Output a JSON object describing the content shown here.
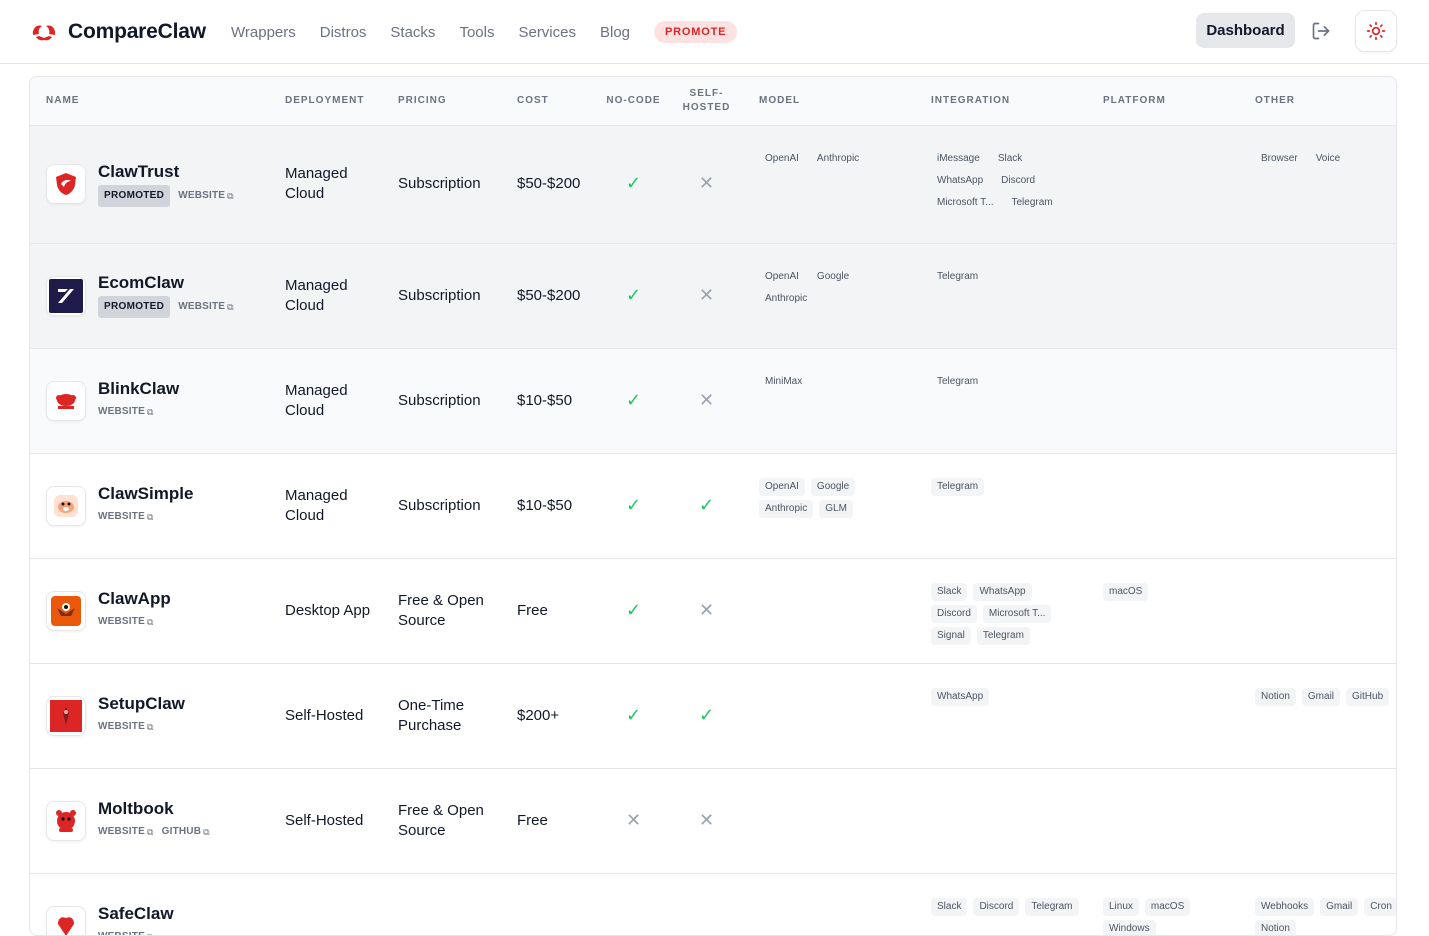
{
  "header": {
    "brand": "CompareClaw",
    "nav": [
      "Wrappers",
      "Distros",
      "Stacks",
      "Tools",
      "Services",
      "Blog"
    ],
    "promote_label": "PROMOTE",
    "dashboard_label": "Dashboard"
  },
  "table": {
    "columns": [
      "NAME",
      "DEPLOYMENT",
      "PRICING",
      "COST",
      "NO-CODE",
      "SELF-HOSTED",
      "MODEL",
      "INTEGRATION",
      "PLATFORM",
      "OTHER"
    ],
    "badge_labels": {
      "promoted": "PROMOTED",
      "website": "WEBSITE",
      "github": "GITHUB"
    },
    "rows": [
      {
        "name": "ClawTrust",
        "promoted": true,
        "links": [
          "WEBSITE"
        ],
        "deployment": "Managed Cloud",
        "pricing": "Subscription",
        "cost": "$50-$200",
        "no_code": true,
        "self_hosted": false,
        "model": [
          "OpenAI",
          "Anthropic"
        ],
        "integration": [
          "iMessage",
          "Slack",
          "WhatsApp",
          "Discord",
          "Microsoft T...",
          "Telegram"
        ],
        "platform": [],
        "other": [
          "Browser",
          "Voice"
        ]
      },
      {
        "name": "EcomClaw",
        "promoted": true,
        "links": [
          "WEBSITE"
        ],
        "deployment": "Managed Cloud",
        "pricing": "Subscription",
        "cost": "$50-$200",
        "no_code": true,
        "self_hosted": false,
        "model": [
          "OpenAI",
          "Google",
          "Anthropic"
        ],
        "integration": [
          "Telegram"
        ],
        "platform": [],
        "other": []
      },
      {
        "name": "BlinkClaw",
        "promoted": false,
        "links": [
          "WEBSITE"
        ],
        "deployment": "Managed Cloud",
        "pricing": "Subscription",
        "cost": "$10-$50",
        "no_code": true,
        "self_hosted": false,
        "model": [
          "MiniMax"
        ],
        "integration": [
          "Telegram"
        ],
        "platform": [],
        "other": []
      },
      {
        "name": "ClawSimple",
        "promoted": false,
        "links": [
          "WEBSITE"
        ],
        "deployment": "Managed Cloud",
        "pricing": "Subscription",
        "cost": "$10-$50",
        "no_code": true,
        "self_hosted": true,
        "model": [
          "OpenAI",
          "Google",
          "Anthropic",
          "GLM"
        ],
        "integration": [
          "Telegram"
        ],
        "platform": [],
        "other": []
      },
      {
        "name": "ClawApp",
        "promoted": false,
        "links": [
          "WEBSITE"
        ],
        "deployment": "Desktop App",
        "pricing": "Free & Open Source",
        "cost": "Free",
        "no_code": true,
        "self_hosted": false,
        "model": [],
        "integration": [
          "Slack",
          "WhatsApp",
          "Discord",
          "Microsoft T...",
          "Signal",
          "Telegram"
        ],
        "platform": [
          "macOS"
        ],
        "other": []
      },
      {
        "name": "SetupClaw",
        "promoted": false,
        "links": [
          "WEBSITE"
        ],
        "deployment": "Self-Hosted",
        "pricing": "One-Time Purchase",
        "cost": "$200+",
        "no_code": true,
        "self_hosted": true,
        "model": [],
        "integration": [
          "WhatsApp"
        ],
        "platform": [],
        "other": [
          "Notion",
          "Gmail",
          "GitHub"
        ]
      },
      {
        "name": "Moltbook",
        "promoted": false,
        "links": [
          "WEBSITE",
          "GITHUB"
        ],
        "deployment": "Self-Hosted",
        "pricing": "Free & Open Source",
        "cost": "Free",
        "no_code": false,
        "self_hosted": false,
        "model": [],
        "integration": [],
        "platform": [],
        "other": []
      },
      {
        "name": "SafeClaw",
        "promoted": false,
        "links": [
          "WEBSITE"
        ],
        "deployment": "",
        "pricing": "",
        "cost": "",
        "no_code": null,
        "self_hosted": null,
        "model": [],
        "integration": [
          "Slack",
          "Discord",
          "Telegram"
        ],
        "platform": [
          "Linux",
          "macOS",
          "Windows"
        ],
        "other": [
          "Webhooks",
          "Gmail",
          "Cron",
          "Notion"
        ]
      }
    ]
  },
  "colors": {
    "accent_red": "#dc2626",
    "check_green": "#22c55e",
    "cross_gray": "#9ca3af"
  },
  "icons": {
    "logout": "logout-icon",
    "theme": "sun-icon",
    "brand": "claw-logo-icon",
    "external": "external-link-icon"
  }
}
